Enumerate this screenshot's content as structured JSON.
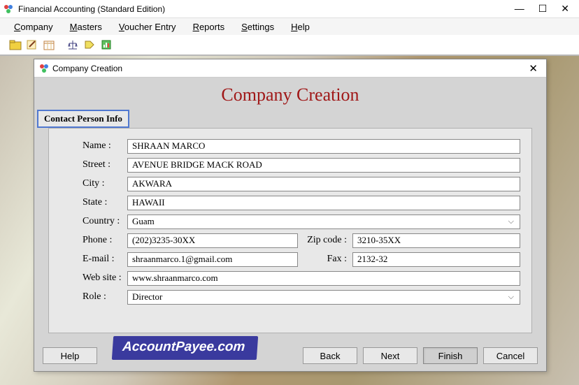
{
  "app": {
    "title": "Financial Accounting (Standard Edition)"
  },
  "menu": {
    "company": "Company",
    "masters": "Masters",
    "voucher": "Voucher Entry",
    "reports": "Reports",
    "settings": "Settings",
    "help": "Help"
  },
  "dialog": {
    "title": "Company Creation",
    "heading": "Company Creation",
    "section": "Contact Person Info"
  },
  "labels": {
    "name": "Name :",
    "street": "Street :",
    "city": "City :",
    "state": "State :",
    "country": "Country :",
    "phone": "Phone :",
    "zipcode": "Zip code :",
    "email": "E-mail :",
    "fax": "Fax :",
    "website": "Web site :",
    "role": "Role :"
  },
  "values": {
    "name": "SHRAAN MARCO",
    "street": "AVENUE BRIDGE MACK ROAD",
    "city": "AKWARA",
    "state": "HAWAII",
    "country": "Guam",
    "phone": "(202)3235-30XX",
    "zipcode": "3210-35XX",
    "email": "shraanmarco.1@gmail.com",
    "fax": "2132-32",
    "website": "www.shraanmarco.com",
    "role": "Director"
  },
  "buttons": {
    "help": "Help",
    "back": "Back",
    "next": "Next",
    "finish": "Finish",
    "cancel": "Cancel"
  },
  "watermark": "AccountPayee.com"
}
